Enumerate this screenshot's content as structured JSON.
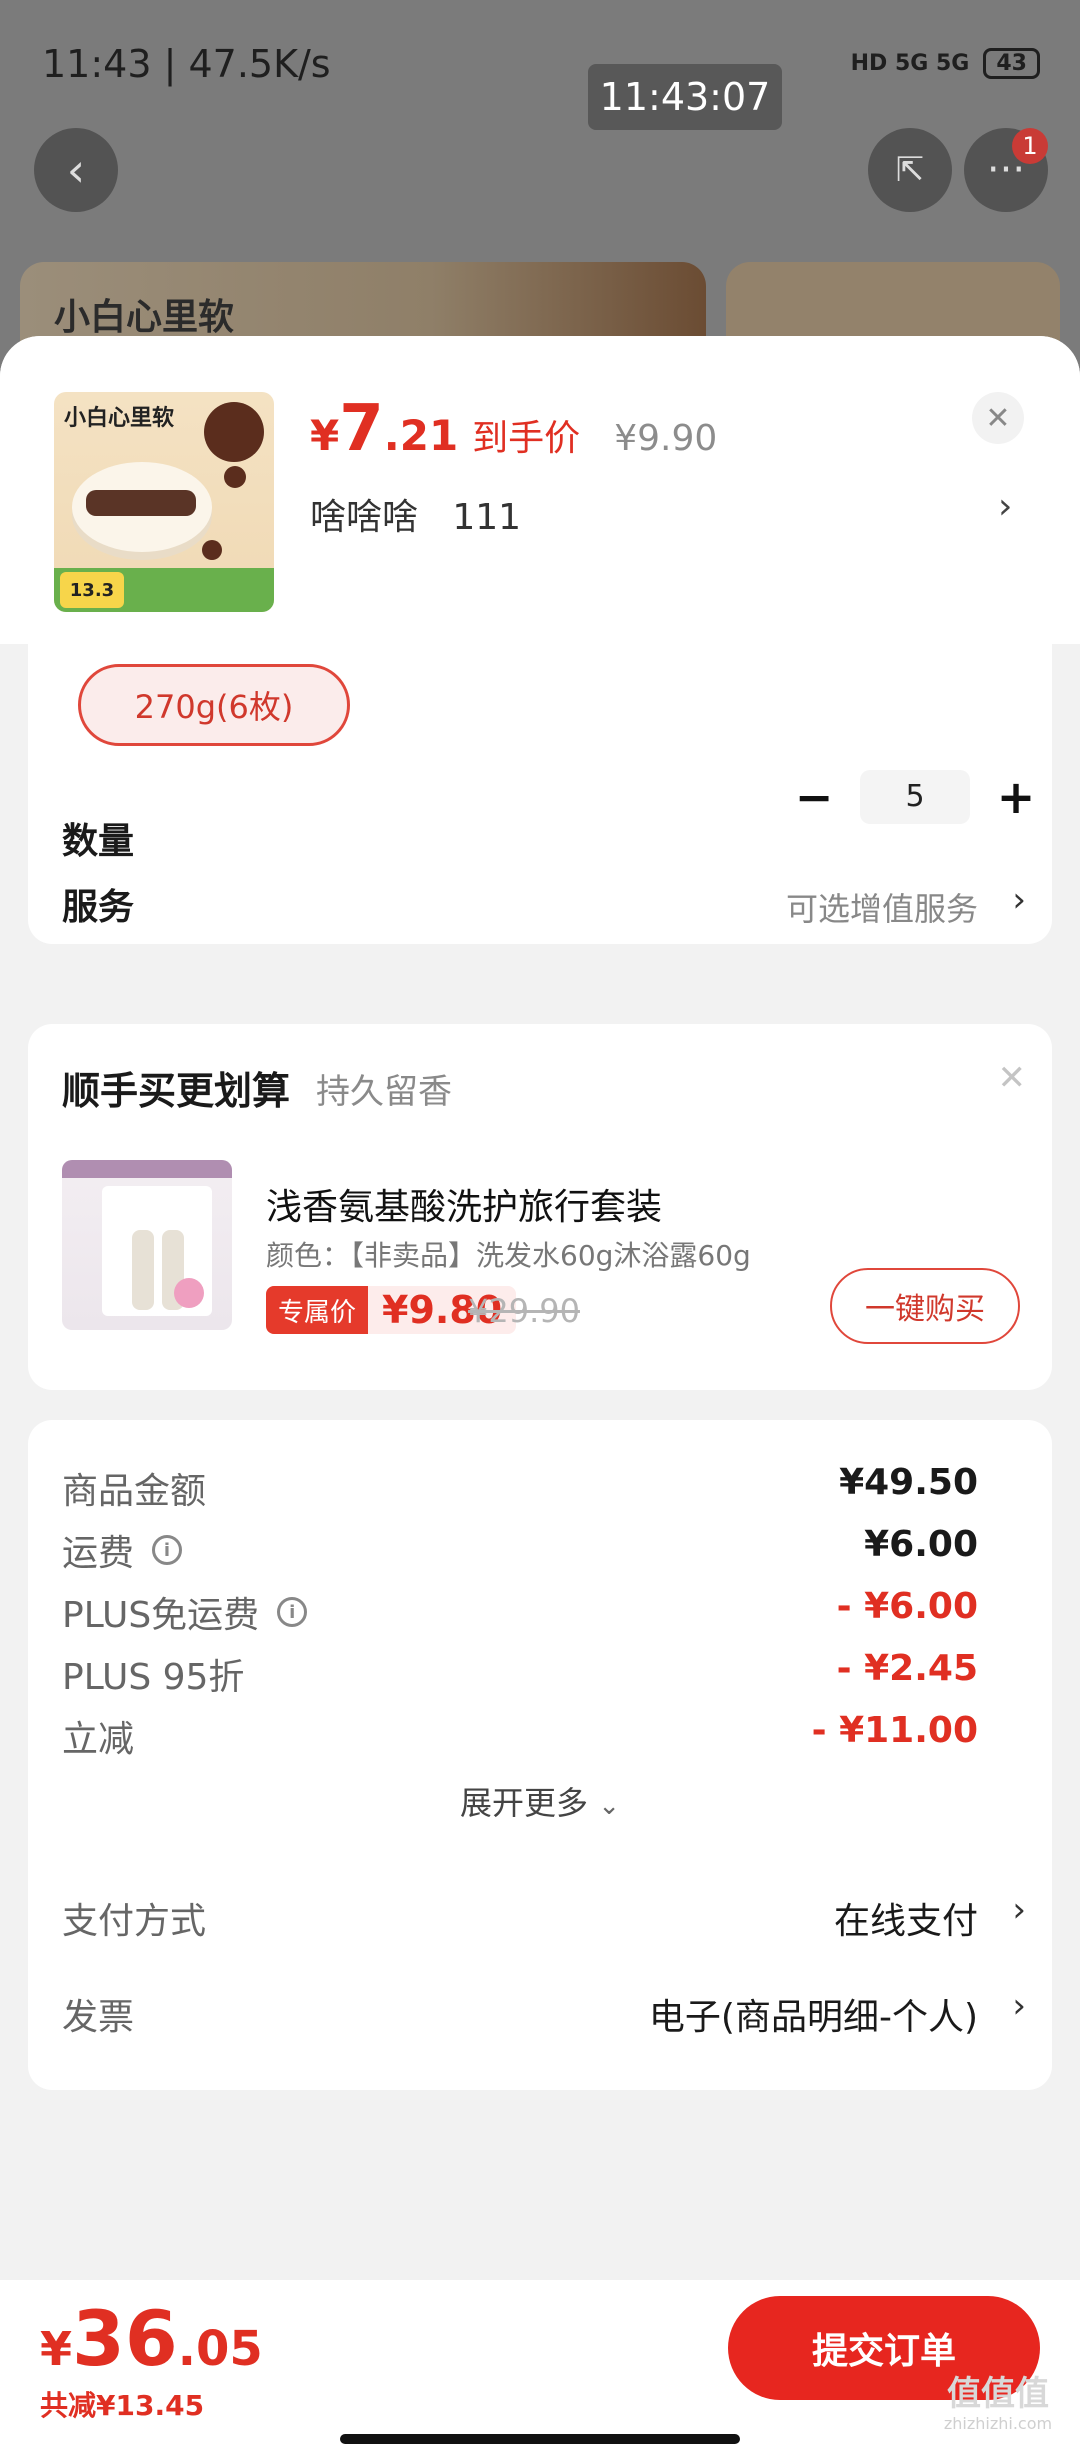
{
  "status_bar": {
    "left_text": "11:43 | 47.5K/s",
    "network": "HD 5G 5G",
    "battery": "43",
    "time_overlay": "11:43:07"
  },
  "background": {
    "brand_text": "小白心里软",
    "notification_badge": "1"
  },
  "product": {
    "price_currency": "¥",
    "price_int": "7",
    "price_dec": ".21",
    "price_label": "到手价",
    "original_price": "¥9.90",
    "selected_text": "啥啥啥   111",
    "thumb_logo": "小白心里软",
    "thumb_tag": "13.3"
  },
  "spec": {
    "selected_option": "270g(6枚)"
  },
  "quantity": {
    "label": "数量",
    "value": "5",
    "minus": "−",
    "plus": "+"
  },
  "service": {
    "label": "服务",
    "value": "可选增值服务"
  },
  "addon": {
    "title": "顺手买更划算",
    "subtitle": "持久留香",
    "name": "浅香氨基酸洗护旅行套装",
    "color_text": "颜色：【非卖品】洗发水60g沐浴露60g",
    "price_tag": "专属价",
    "price": "¥9.80",
    "old_price": "¥29.90",
    "buy_label": "一键购买"
  },
  "fees": [
    {
      "label": "商品金额",
      "value": "¥49.50",
      "info": false,
      "red": false
    },
    {
      "label": "运费",
      "value": "¥6.00",
      "info": true,
      "red": false
    },
    {
      "label": "PLUS免运费",
      "value": "- ¥6.00",
      "info": true,
      "red": true
    },
    {
      "label": "PLUS 95折",
      "value": "- ¥2.45",
      "info": false,
      "red": true
    },
    {
      "label": "立减",
      "value": "- ¥11.00",
      "info": false,
      "red": true
    }
  ],
  "expand_label": "展开更多",
  "payment": {
    "method_label": "支付方式",
    "method_value": "在线支付",
    "invoice_label": "发票",
    "invoice_value": "电子(商品明细-个人)"
  },
  "footer": {
    "currency": "¥",
    "total_int": "36",
    "total_dec": ".05",
    "saved_text": "共减¥13.45",
    "submit_label": "提交订单",
    "watermark": "值值值",
    "watermark_url": "zhizhizhi.com"
  },
  "colors": {
    "accent_red": "#e02f22",
    "button_red": "#e7261f",
    "overlay_gray": "#7b7b7b"
  }
}
